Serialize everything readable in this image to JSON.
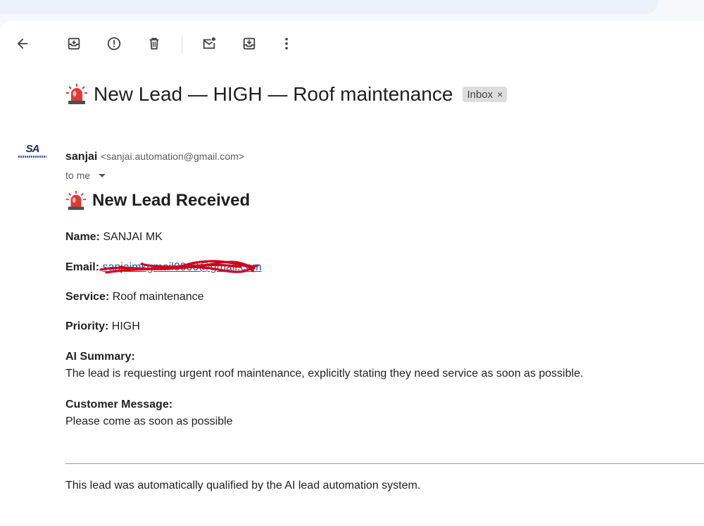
{
  "subject": {
    "text": "New Lead — HIGH — Roof maintenance",
    "label": "Inbox"
  },
  "sender": {
    "name": "sanjai",
    "email": "<sanjai.automation@gmail.com>",
    "to": "to me",
    "avatar_text": "SA"
  },
  "body": {
    "heading": "New Lead Received",
    "name_label": "Name:",
    "name_value": "SANJAI MK",
    "email_label": "Email:",
    "email_value": "sanjaimkgmail0000@gmail.com",
    "service_label": "Service:",
    "service_value": "Roof maintenance",
    "priority_label": "Priority:",
    "priority_value": "HIGH",
    "summary_label": "AI Summary:",
    "summary_value": "The lead is requesting urgent roof maintenance, explicitly stating they need service as soon as possible.",
    "message_label": "Customer Message:",
    "message_value": "Please come as soon as possible",
    "footer": "This lead was automatically qualified by the AI lead automation system."
  },
  "colors": {
    "link": "#1a55c4",
    "siren_red": "#e53935",
    "scribble": "#d0021b"
  },
  "icons": [
    "back-arrow-icon",
    "archive-icon",
    "report-spam-icon",
    "delete-icon",
    "mark-unread-icon",
    "move-to-icon",
    "more-vert-icon",
    "siren-emoji-icon"
  ]
}
